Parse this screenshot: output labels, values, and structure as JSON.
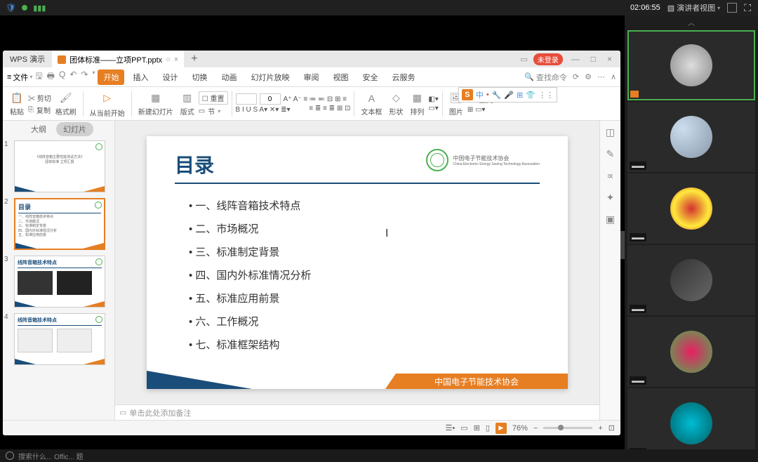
{
  "browser": {
    "shield": "🛡"
  },
  "vc": {
    "timer": "02:06:55",
    "presenter_view": "演讲者视图",
    "participants": [
      {
        "active": true,
        "cam": true
      },
      {
        "active": false
      },
      {
        "active": false
      },
      {
        "active": false
      },
      {
        "active": false
      },
      {
        "active": false
      }
    ]
  },
  "wps": {
    "app_name": "WPS 演示",
    "tab_title": "团体标准——立项PPT.pptx",
    "plus": "+",
    "login": "未登录",
    "file_menu": "文件",
    "toolbar_icons": [
      "⎘",
      "🖶",
      "Q",
      "↶",
      "↷"
    ],
    "menus": [
      "开始",
      "插入",
      "设计",
      "切换",
      "动画",
      "幻灯片放映",
      "审阅",
      "视图",
      "安全",
      "云服务"
    ],
    "active_menu": 0,
    "search_cmd": "查找命令",
    "ribbon": {
      "paste": "粘贴",
      "copy": "复制",
      "format_painter": "格式刷",
      "from_current": "从当前开始",
      "new_slide": "新建幻灯片",
      "layout": "版式",
      "reset": "重置",
      "section": "节",
      "font_size": "0",
      "textbox": "文本框",
      "shape": "形状",
      "arrange": "排列",
      "image": "图片",
      "find": "查找"
    },
    "ime": {
      "s": "S",
      "zh": "中",
      "icons": [
        "•",
        "🔧",
        "🔍",
        "⊞",
        "👕",
        "⋮⋮"
      ]
    },
    "outline": {
      "tab1": "大纲",
      "tab2": "幻灯片",
      "active": 1
    },
    "thumbs": [
      {
        "num": "1",
        "title": "《线阵音箱主要性能测试方法》",
        "sub": "团体标准 立项汇报"
      },
      {
        "num": "2",
        "title": "目录",
        "lines": [
          "一、线阵音箱技术特点",
          "二、市场概况",
          "三、标准制定背景",
          "四、国内外标准情况分析",
          "五、标准应用前景",
          "六、工作概况",
          "七、标准框架结构"
        ]
      },
      {
        "num": "3",
        "title": "线阵音箱技术特点"
      },
      {
        "num": "4",
        "title": "线阵音箱技术特点"
      }
    ],
    "slide": {
      "title": "目录",
      "org_name": "中国电子节能技术协会",
      "org_sub": "China Electronic Energy Saving Technology Association",
      "items": [
        "一、线阵音箱技术特点",
        "二、市场概况",
        "三、标准制定背景",
        "四、国内外标准情况分析",
        "五、标准应用前景",
        "六、工作概况",
        "七、标准框架结构"
      ],
      "footer_text": "中国电子节能技术协会"
    },
    "notes_placeholder": "单击此处添加备注",
    "status": {
      "zoom": "76%",
      "minus": "−",
      "plus": "+"
    },
    "taskbar_text": "搜索什么... Offic... 题"
  }
}
